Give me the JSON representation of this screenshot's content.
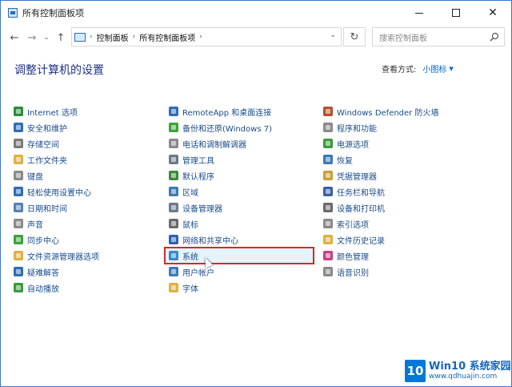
{
  "window": {
    "title": "所有控制面板项"
  },
  "nav": {
    "back_glyph": "←",
    "forward_glyph": "→",
    "recent_glyph": "⌄",
    "up_glyph": "↑",
    "breadcrumb": [
      "控制面板",
      "所有控制面板项"
    ],
    "search_placeholder": "搜索控制面板",
    "refresh_glyph": "↻"
  },
  "controls": {
    "close_glyph": "✕"
  },
  "page": {
    "title": "调整计算机的设置",
    "view_by_label": "查看方式:",
    "view_by_value": "小图标"
  },
  "columns": [
    [
      {
        "label": "Internet 选项",
        "icon": "globe-icon",
        "color": "#2a8c3a"
      },
      {
        "label": "安全和维护",
        "icon": "flag-icon",
        "color": "#2f6db5"
      },
      {
        "label": "存储空间",
        "icon": "storage-icon",
        "color": "#7a7a7a"
      },
      {
        "label": "工作文件夹",
        "icon": "folder-icon",
        "color": "#e0b040"
      },
      {
        "label": "键盘",
        "icon": "keyboard-icon",
        "color": "#8a8a8a"
      },
      {
        "label": "轻松使用设置中心",
        "icon": "accessibility-icon",
        "color": "#2f6db5"
      },
      {
        "label": "日期和时间",
        "icon": "clock-icon",
        "color": "#5a7fb5"
      },
      {
        "label": "声音",
        "icon": "speaker-icon",
        "color": "#8a8a8a"
      },
      {
        "label": "同步中心",
        "icon": "sync-icon",
        "color": "#3aa43a"
      },
      {
        "label": "文件资源管理器选项",
        "icon": "folder-options-icon",
        "color": "#e0b040"
      },
      {
        "label": "疑难解答",
        "icon": "troubleshoot-icon",
        "color": "#2f6db5"
      },
      {
        "label": "自动播放",
        "icon": "autoplay-icon",
        "color": "#3a9a3a"
      }
    ],
    [
      {
        "label": "RemoteApp 和桌面连接",
        "icon": "remote-desktop-icon",
        "color": "#2f6db5"
      },
      {
        "label": "备份和还原(Windows 7)",
        "icon": "backup-icon",
        "color": "#3aa43a"
      },
      {
        "label": "电话和调制解调器",
        "icon": "phone-icon",
        "color": "#8a8a8a"
      },
      {
        "label": "管理工具",
        "icon": "admin-tools-icon",
        "color": "#6a7a8a"
      },
      {
        "label": "默认程序",
        "icon": "default-programs-icon",
        "color": "#3a8a3a"
      },
      {
        "label": "区域",
        "icon": "region-icon",
        "color": "#3a7ab5"
      },
      {
        "label": "设备管理器",
        "icon": "device-manager-icon",
        "color": "#6a7a8a"
      },
      {
        "label": "鼠标",
        "icon": "mouse-icon",
        "color": "#6a6a6a"
      },
      {
        "label": "网络和共享中心",
        "icon": "network-icon",
        "color": "#2f5fb5"
      },
      {
        "label": "系统",
        "icon": "system-icon",
        "color": "#3a8ac5",
        "selected": true
      },
      {
        "label": "用户帐户",
        "icon": "user-accounts-icon",
        "color": "#3a7ab5"
      },
      {
        "label": "字体",
        "icon": "fonts-icon",
        "color": "#e0b040"
      }
    ],
    [
      {
        "label": "Windows Defender 防火墙",
        "icon": "firewall-icon",
        "color": "#b5502f"
      },
      {
        "label": "程序和功能",
        "icon": "programs-icon",
        "color": "#8a8a8a"
      },
      {
        "label": "电源选项",
        "icon": "power-icon",
        "color": "#3a9a3a"
      },
      {
        "label": "恢复",
        "icon": "recovery-icon",
        "color": "#3a7ab5"
      },
      {
        "label": "凭据管理器",
        "icon": "credentials-icon",
        "color": "#c8a030"
      },
      {
        "label": "任务栏和导航",
        "icon": "taskbar-icon",
        "color": "#3a5fa5"
      },
      {
        "label": "设备和打印机",
        "icon": "printer-icon",
        "color": "#6a6a6a"
      },
      {
        "label": "索引选项",
        "icon": "indexing-icon",
        "color": "#8a8a8a"
      },
      {
        "label": "文件历史记录",
        "icon": "file-history-icon",
        "color": "#e0b040"
      },
      {
        "label": "颜色管理",
        "icon": "color-management-icon",
        "color": "#c84080"
      },
      {
        "label": "语音识别",
        "icon": "microphone-icon",
        "color": "#8a8a8a"
      }
    ]
  ],
  "watermark": {
    "logo": "10",
    "text": "Win10 系统家园",
    "url": "www.qdhuajin.com"
  }
}
